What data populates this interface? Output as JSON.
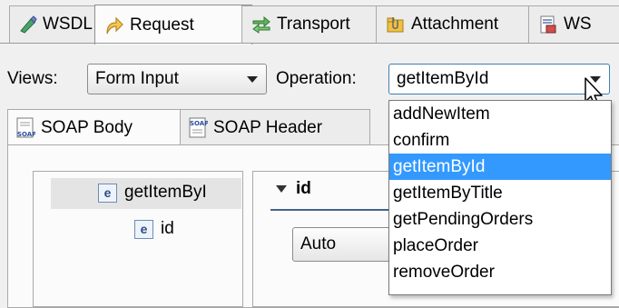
{
  "top_tabs": [
    {
      "label": "WSDL",
      "icon": "wsdl-icon"
    },
    {
      "label": "Request",
      "icon": "request-arrow-icon",
      "active": true
    },
    {
      "label": "Transport",
      "icon": "transport-arrows-icon"
    },
    {
      "label": "Attachment",
      "icon": "attachment-folder-icon"
    },
    {
      "label": "WS",
      "icon": "ws-security-icon"
    }
  ],
  "toolbar": {
    "views_label": "Views:",
    "views_value": "Form Input",
    "operation_label": "Operation:",
    "operation_value": "getItemById"
  },
  "sub_tabs": [
    {
      "label": "SOAP Body",
      "icon": "soap-icon",
      "active": true
    },
    {
      "label": "SOAP Header",
      "icon": "soap-icon"
    }
  ],
  "tree": {
    "root_label": "getItemByI",
    "child_label": "id"
  },
  "detail": {
    "field_label": "id",
    "mode_value": "Auto"
  },
  "operation_options": [
    "addNewItem",
    "confirm",
    "getItemById",
    "getItemByTitle",
    "getPendingOrders",
    "placeOrder",
    "removeOrder"
  ],
  "selected_operation_index": 2
}
